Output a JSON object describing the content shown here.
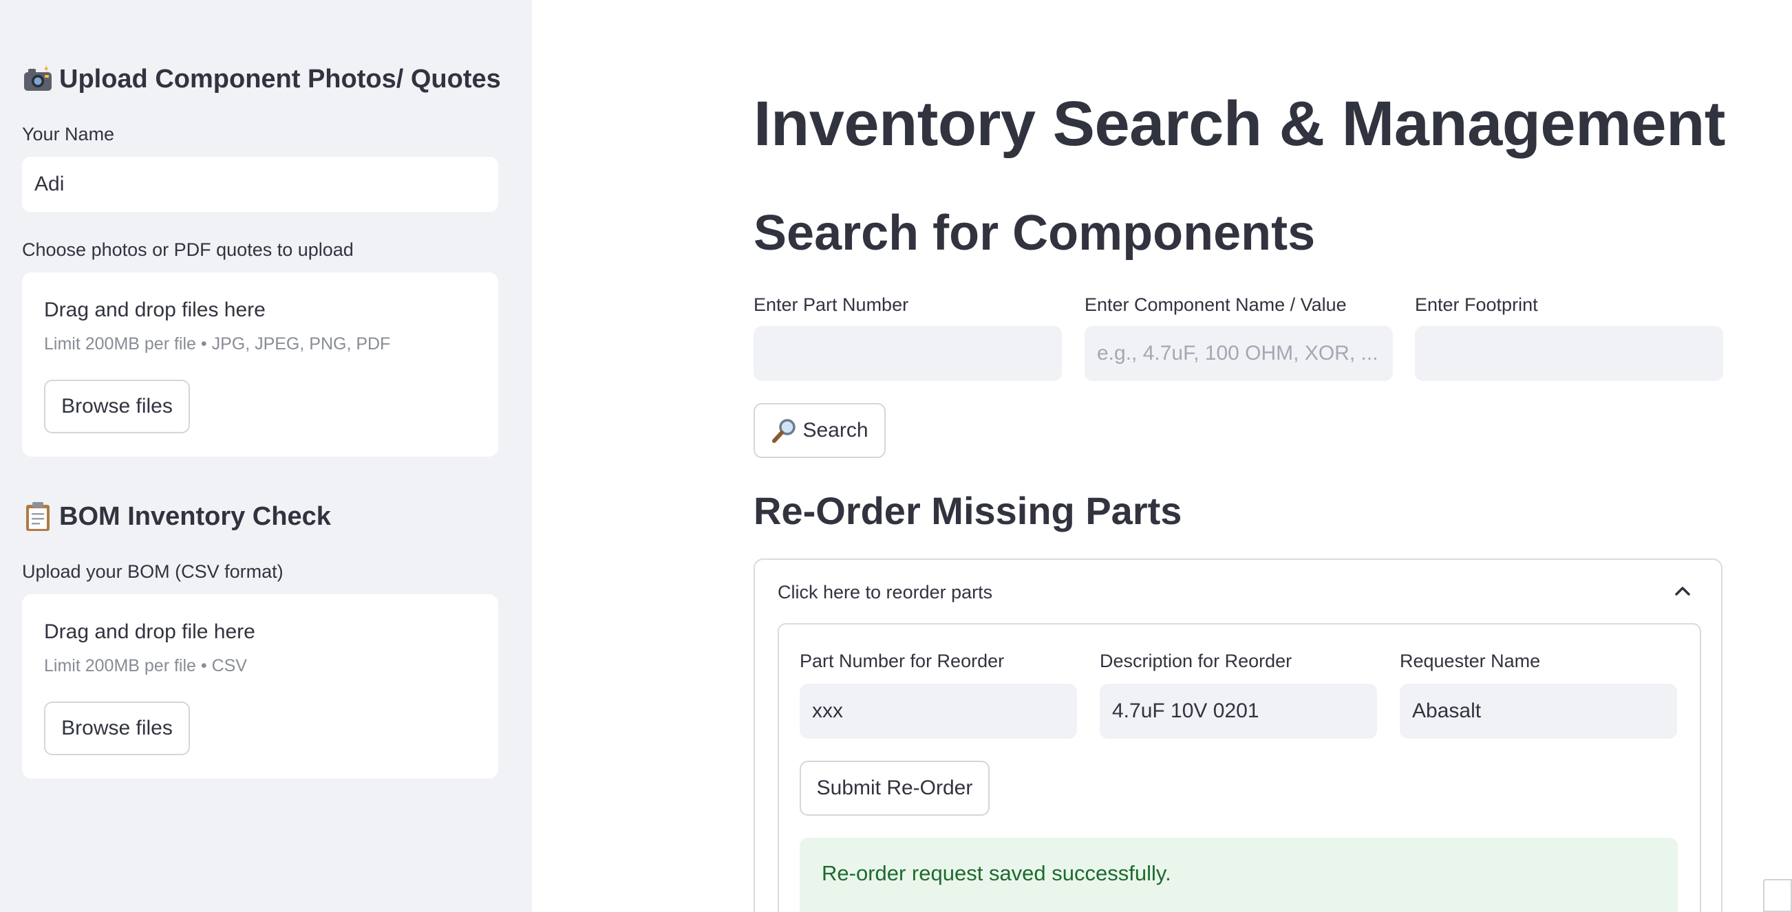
{
  "sidebar": {
    "upload_section": {
      "icon": "camera-flash-icon",
      "title": "Upload Component Photos/ Quotes",
      "name_label": "Your Name",
      "name_value": "Adi",
      "upload_label": "Choose photos or PDF quotes to upload",
      "dropzone_title": "Drag and drop files here",
      "dropzone_limit": "Limit 200MB per file • JPG, JPEG, PNG, PDF",
      "browse_label": "Browse files"
    },
    "bom_section": {
      "icon": "clipboard-icon",
      "title": "BOM Inventory Check",
      "upload_label": "Upload your BOM (CSV format)",
      "dropzone_title": "Drag and drop file here",
      "dropzone_limit": "Limit 200MB per file • CSV",
      "browse_label": "Browse files"
    }
  },
  "main": {
    "title": "Inventory Search & Management",
    "search_heading": "Search for Components",
    "part_number_label": "Enter Part Number",
    "part_number_value": "",
    "component_label": "Enter Component Name / Value",
    "component_placeholder": "e.g., 4.7uF, 100 OHM, XOR, ...",
    "footprint_label": "Enter Footprint",
    "footprint_value": "",
    "search_icon": "magnifier-icon",
    "search_button": "Search",
    "reorder_heading": "Re-Order Missing Parts",
    "expander_label": "Click here to reorder parts",
    "reorder_part_label": "Part Number for Reorder",
    "reorder_part_value": "xxx",
    "reorder_desc_label": "Description for Reorder",
    "reorder_desc_value": "4.7uF 10V 0201",
    "requester_label": "Requester Name",
    "requester_value": "Abasalt",
    "submit_button": "Submit Re-Order",
    "success_message": "Re-order request saved successfully."
  },
  "colors": {
    "sidebar_bg": "#f0f2f6",
    "text": "#31333f",
    "success_bg": "#eaf6ec",
    "success_text": "#1c6b2e"
  }
}
